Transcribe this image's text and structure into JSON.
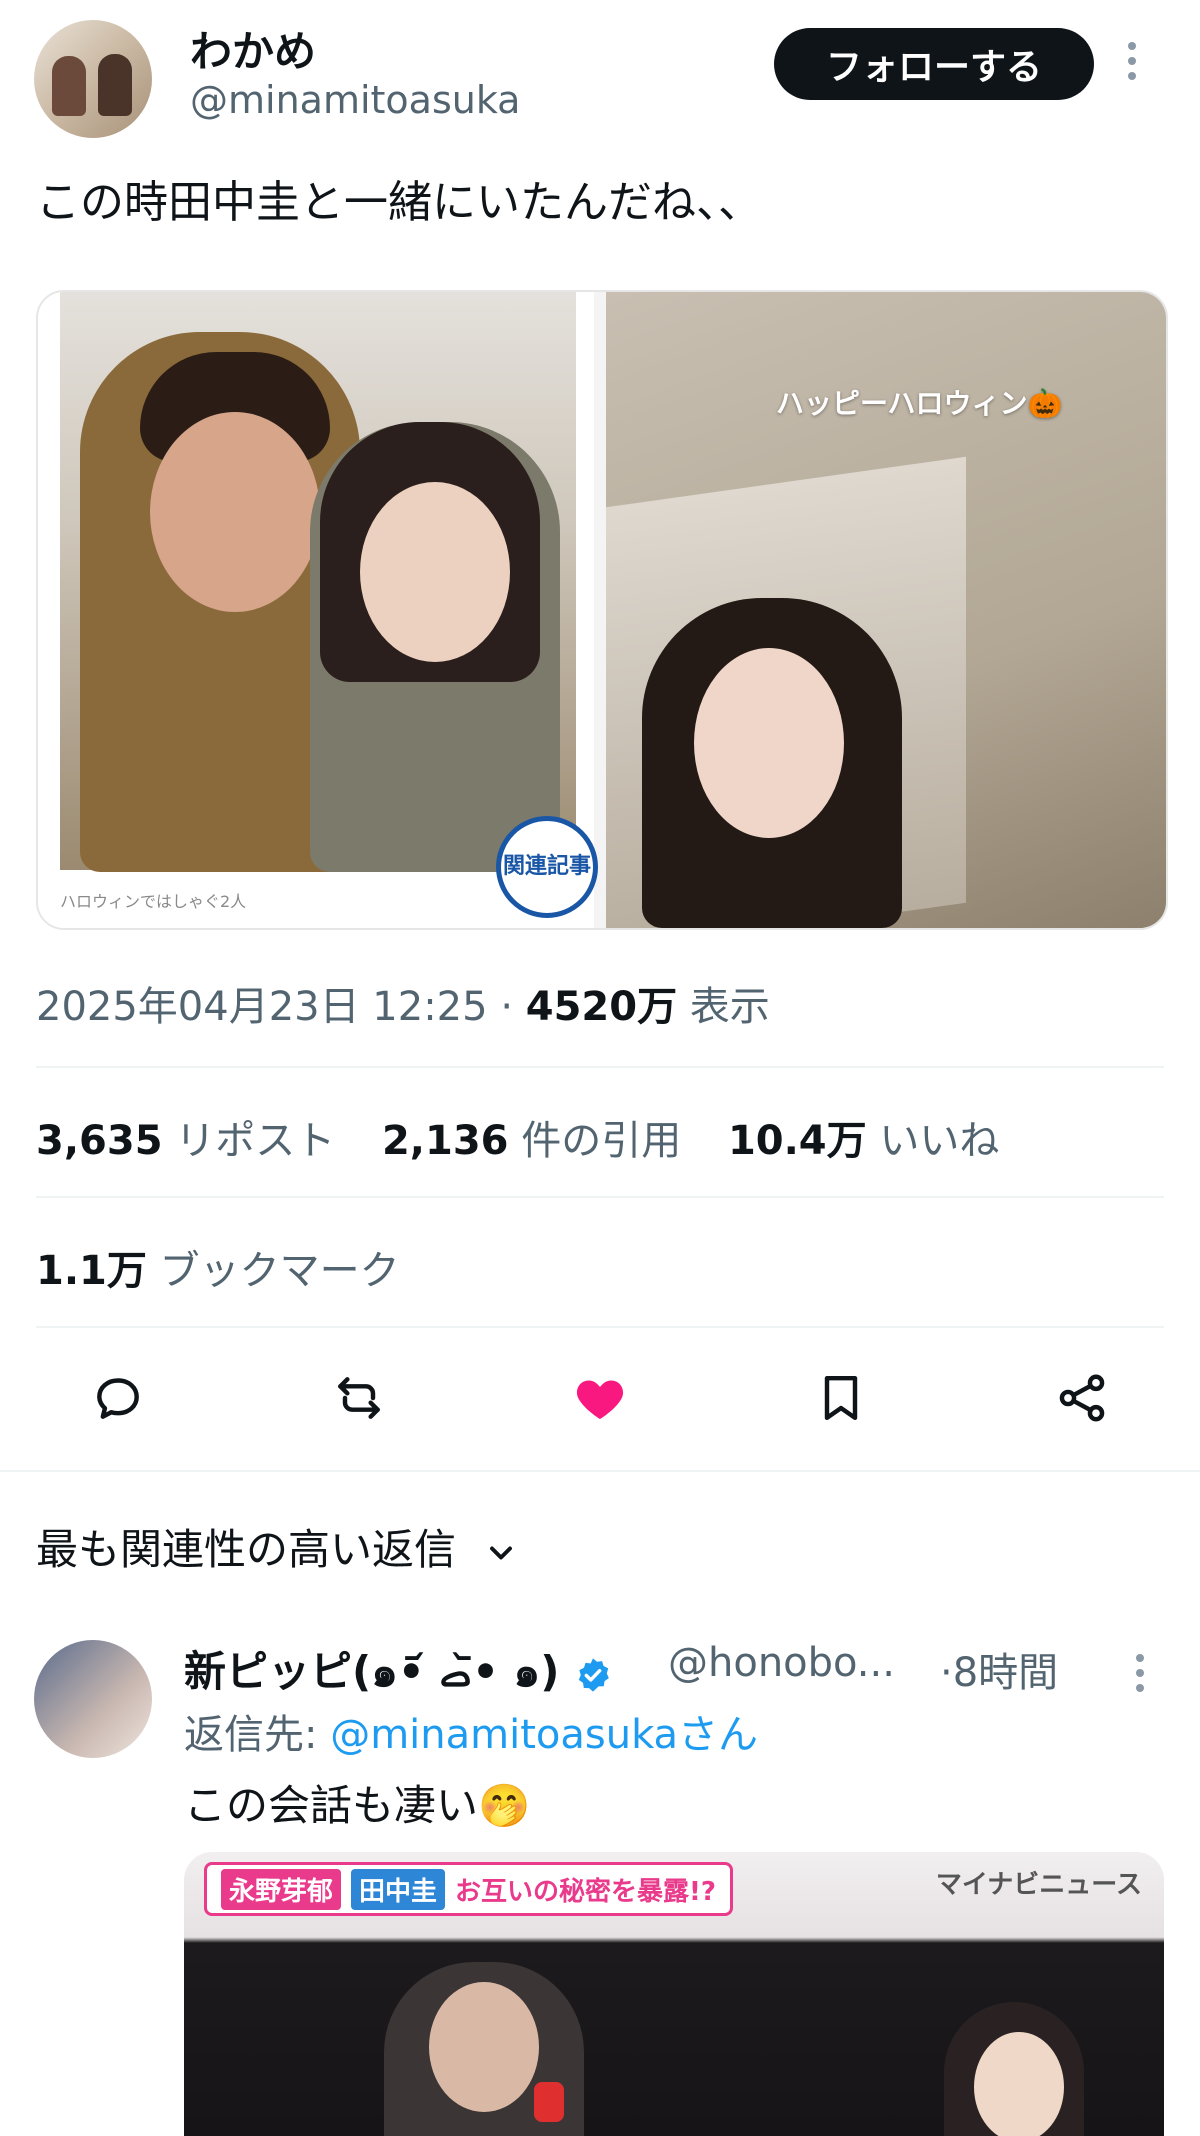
{
  "tweet": {
    "display_name": "わかめ",
    "handle": "@minamitoasuka",
    "follow_label": "フォローする",
    "text": "この時田中圭と一緒にいたんだね、、",
    "media": {
      "left_caption": "ハロウィンではしゃぐ2人",
      "left_badge": "関連記事",
      "right_overlay_text": "ハッピーハロウィン🎃"
    },
    "timestamp": "2025年04月23日 12:25",
    "separator": "·",
    "views_count": "4520万",
    "views_label": "表示",
    "reposts_count": "3,635",
    "reposts_label": "リポスト",
    "quotes_count": "2,136",
    "quotes_label": "件の引用",
    "likes_count": "10.4万",
    "likes_label": "いいね",
    "bookmarks_count": "1.1万",
    "bookmarks_label": "ブックマーク",
    "liked": true,
    "like_color": "#f91880"
  },
  "replies": {
    "header": "最も関連性の高い返信",
    "items": [
      {
        "display_name": "新ピッピ(๑•᷄ ࡇ•᷅ ๑)",
        "verified": true,
        "handle": "@honobo...",
        "time": "·8時間",
        "reply_to_prefix": "返信先:",
        "reply_to_link": "@minamitoasukaさん",
        "text": "この会話も凄い🤭",
        "media": {
          "banner_name1": "永野芽郁",
          "banner_name2": "田中圭",
          "banner_headline": "お互いの秘密を暴露!?",
          "brand": "マイナビニュース"
        }
      }
    ]
  },
  "colors": {
    "text_primary": "#0f1419",
    "text_secondary": "#536471",
    "link": "#1d9bf0",
    "verified": "#1d9bf0"
  }
}
